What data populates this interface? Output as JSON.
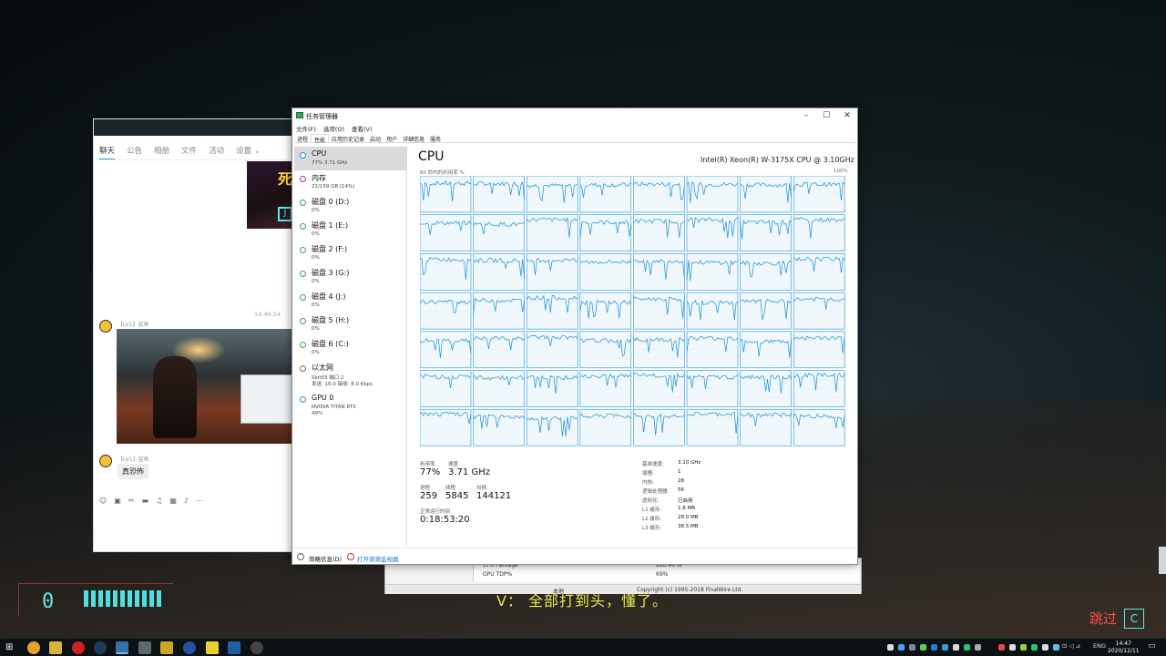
{
  "background": {
    "hud_value": "0",
    "subtitle": "V：  全部打到头，懂了。",
    "skip_label": "跳过",
    "skip_key": "C"
  },
  "chat": {
    "tabs": [
      "聊天",
      "公告",
      "相册",
      "文件",
      "活动",
      "设置"
    ],
    "time": "14:46:54",
    "user1": "【LV1】鲨鱼",
    "user2": "【LV1】鲨鱼",
    "message": "真恐怖",
    "game_char": "死",
    "game_key": "J"
  },
  "taskmanager": {
    "title": "任务管理器",
    "menu": [
      "文件(F)",
      "选项(O)",
      "查看(V)"
    ],
    "tabs": [
      "进程",
      "性能",
      "应用历史记录",
      "启动",
      "用户",
      "详细信息",
      "服务"
    ],
    "active_tab": "性能",
    "sidebar": [
      {
        "name": "CPU",
        "sub": "77%  3.71 GHz",
        "sub2": "",
        "color": "#1a8fd6"
      },
      {
        "name": "内存",
        "sub": "22/159 GB (14%)",
        "sub2": "",
        "color": "#9b2fae"
      },
      {
        "name": "磁盘 0 (D:)",
        "sub": "0%",
        "sub2": "",
        "color": "#3aa35a"
      },
      {
        "name": "磁盘 1 (E:)",
        "sub": "0%",
        "sub2": "",
        "color": "#3aa35a"
      },
      {
        "name": "磁盘 2 (F:)",
        "sub": "0%",
        "sub2": "",
        "color": "#3aa35a"
      },
      {
        "name": "磁盘 3 (G:)",
        "sub": "0%",
        "sub2": "",
        "color": "#3aa35a"
      },
      {
        "name": "磁盘 4 (J:)",
        "sub": "0%",
        "sub2": "",
        "color": "#3aa35a"
      },
      {
        "name": "磁盘 5 (H:)",
        "sub": "0%",
        "sub2": "",
        "color": "#3aa35a"
      },
      {
        "name": "磁盘 6 (C:)",
        "sub": "0%",
        "sub2": "",
        "color": "#3aa35a"
      },
      {
        "name": "以太网",
        "sub": "Slot03 端口 2",
        "sub2": "发送: 16.0 接收: 8.0 Kbps",
        "color": "#a0622d"
      },
      {
        "name": "GPU 0",
        "sub": "NVIDIA TITAN RTX",
        "sub2": "49%",
        "color": "#1a8fd6"
      }
    ],
    "main_title": "CPU",
    "cpu_model": "Intel(R) Xeon(R) W-3175X CPU @ 3.10GHz",
    "graph_label": "60 秒内的利用率 %",
    "graph_max": "100%",
    "stats": {
      "util_label": "利用率",
      "util_value": "77%",
      "speed_label": "速度",
      "speed_value": "3.71 GHz",
      "proc_label": "进程",
      "proc_value": "259",
      "thread_label": "线程",
      "thread_value": "5845",
      "handle_label": "句柄",
      "handle_value": "144121",
      "uptime_label": "正常运行时间",
      "uptime_value": "0:18:53:20"
    },
    "details": [
      {
        "k": "基准速度:",
        "v": "3.10 GHz"
      },
      {
        "k": "插槽:",
        "v": "1"
      },
      {
        "k": "内核:",
        "v": "28"
      },
      {
        "k": "逻辑处理器:",
        "v": "56"
      },
      {
        "k": "虚拟化:",
        "v": "已启用"
      },
      {
        "k": "L1 缓存:",
        "v": "1.8 MB"
      },
      {
        "k": "L2 缓存:",
        "v": "28.0 MB"
      },
      {
        "k": "L3 缓存:",
        "v": "38.5 MB"
      }
    ],
    "brief_label": "简略信息(D)",
    "resmon_label": "打开资源监视器"
  },
  "finalwire": {
    "row1_name": "CPU Package",
    "row1_value": "286.46 W",
    "row2_name": "GPU TDP%",
    "row2_value": "69%",
    "status_left": "本地",
    "status_right": "Copyright (c) 1995-2018 FinalWire Ltd."
  },
  "taskbar": {
    "lang": "ENG",
    "time": "14:47",
    "date": "2020/12/11"
  },
  "colors": {
    "graph_line": "#1a8fd6",
    "graph_fill": "#f1f8fc",
    "graph_border": "#1a8fd6"
  }
}
